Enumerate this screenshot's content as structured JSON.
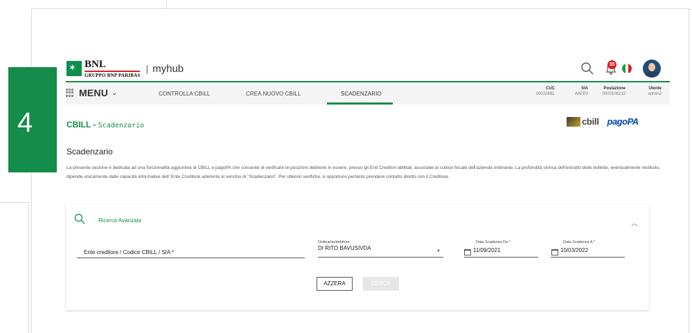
{
  "step_label": "4",
  "brand": {
    "logo_name": "BNL",
    "logo_group": "GRUPPO BNP PARIBAS",
    "separator": "|",
    "app_name": "myhub"
  },
  "header_icons": {
    "search": "search-icon",
    "notifications_count": "35",
    "language_flag": "it-flag",
    "avatar": "user-avatar"
  },
  "menu": {
    "label": "MENU",
    "chevron": "⌄",
    "items": [
      {
        "label": "CONTROLLA CBILL"
      },
      {
        "label": "CREA NUOVO CBILL"
      },
      {
        "label": "SCADENZARIO",
        "active": true
      }
    ],
    "info": [
      {
        "key": "CUC",
        "value": "000328BL"
      },
      {
        "key": "SIA",
        "value": "AAFP0"
      },
      {
        "key": "Postazione",
        "value": "0000106233"
      },
      {
        "key": "Utente",
        "value": "admin2"
      }
    ]
  },
  "page": {
    "title_main": "CBILL",
    "title_sep": " - ",
    "title_sub": "Scadenzario",
    "cbill_logo_text": "cbill",
    "pagopa_logo_text": "pagoPA",
    "section_title": "Scadenzario",
    "description": "La presente sezione è dedicata ad una funzionalità aggiuntiva di CBILL e pagoPA che consente di verificare le posizioni debitorie in essere, presso gli Enti Creditori abilitati, associate al codice fiscale dell'azienda ordinante. La profondità storica dell'estratto delle bollette, eventualmente restituito, dipende unicamente dalle capacità informative dell' Ente Creditore aderente al servizio di \"Scadenzario\". Per ulteriori verifiche, è opportuno pertanto prendere contatto diretto con il Creditore."
  },
  "search_panel": {
    "title": "Ricerca Avanzata",
    "collapse_glyph": "︿",
    "fields": {
      "ente_label": "Ente creditore / Codice CBILL / SIA *",
      "ordinante_label": "Ordinante/debitore",
      "ordinante_value": "DI RITO BAVUSIVDA",
      "data_da_label": "Data Scadenza Da *",
      "data_da_value": "11/09/2021",
      "data_a_label": "Data Scadenza A *",
      "data_a_value": "10/03/2022"
    },
    "buttons": {
      "reset": "AZZERA",
      "search": "CERCA"
    }
  },
  "colors": {
    "brand_green": "#148c4a",
    "badge_red": "#d61f26",
    "pagopa_blue": "#0047ab"
  }
}
